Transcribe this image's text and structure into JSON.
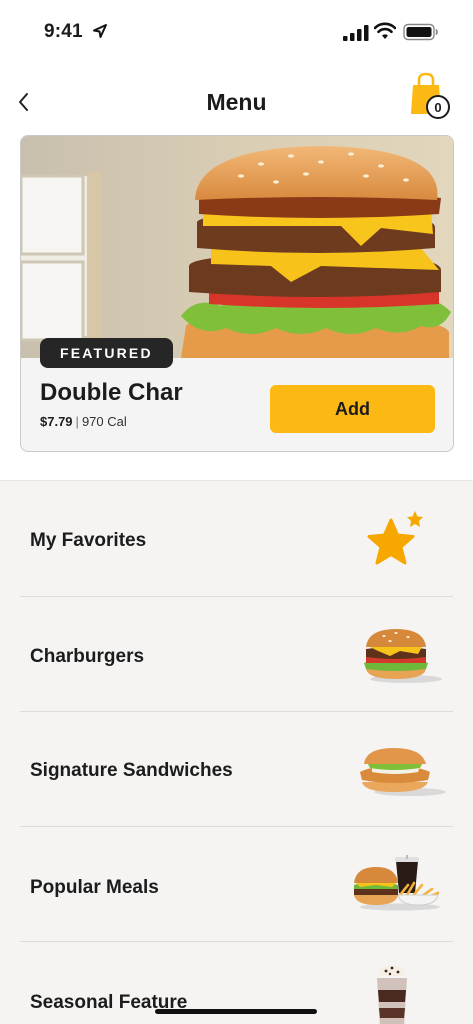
{
  "status_bar": {
    "time": "9:41"
  },
  "nav": {
    "title": "Menu",
    "cart_count": "0"
  },
  "featured": {
    "badge": "FEATURED",
    "name": "Double Char",
    "price": "$7.79",
    "separator": "|",
    "calories": "970 Cal",
    "add_label": "Add"
  },
  "menu": {
    "items": [
      {
        "label": "My Favorites",
        "icon": "star-icon"
      },
      {
        "label": "Charburgers",
        "icon": "burger-icon"
      },
      {
        "label": "Signature Sandwiches",
        "icon": "sandwich-icon"
      },
      {
        "label": "Popular Meals",
        "icon": "meal-icon"
      },
      {
        "label": "Seasonal Feature",
        "icon": "shake-icon"
      }
    ]
  },
  "colors": {
    "accent": "#fdb913",
    "badge_bg": "#262626",
    "star": "#f6a800"
  }
}
